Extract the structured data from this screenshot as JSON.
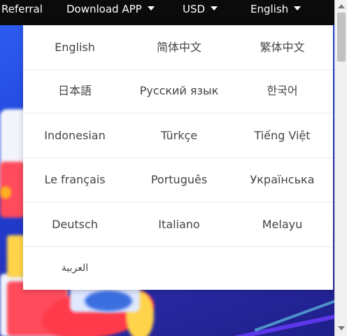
{
  "nav": {
    "referral": "Referral",
    "download": "Download APP",
    "currency": "USD",
    "language": "English"
  },
  "languages": [
    [
      "English",
      "简体中文",
      "繁体中文"
    ],
    [
      "日本語",
      "Русский язык",
      "한국어"
    ],
    [
      "Indonesian",
      "Türkçe",
      "Tiếng Việt"
    ],
    [
      "Le français",
      "Português",
      "Українська"
    ],
    [
      "Deutsch",
      "Italiano",
      "Melayu"
    ],
    [
      "العربية"
    ]
  ],
  "colors": {
    "topbar_bg": "#0b0b0b",
    "dropdown_bg": "#ffffff",
    "lang_text": "#444444",
    "bg_blue": "#1d3ed6"
  },
  "icons": {
    "caret": "chevron-down-icon"
  }
}
